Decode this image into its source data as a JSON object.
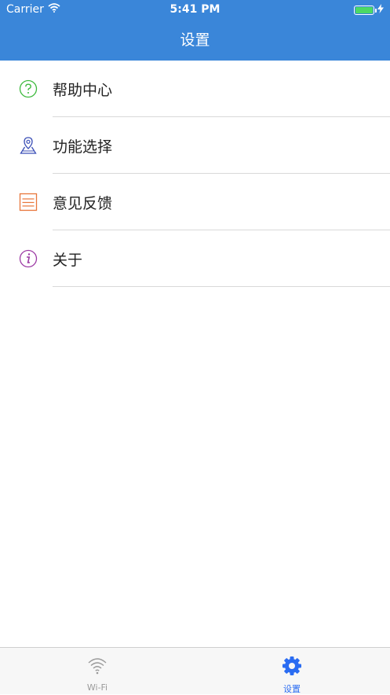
{
  "status_bar": {
    "carrier": "Carrier",
    "time": "5:41 PM",
    "battery_color": "#4cd964"
  },
  "nav": {
    "title": "设置",
    "background": "#3a86d9"
  },
  "menu": {
    "items": [
      {
        "label": "帮助中心",
        "icon": "help-icon",
        "icon_color": "#3cb93c"
      },
      {
        "label": "功能选择",
        "icon": "location-pin-icon",
        "icon_color": "#3b4fb6"
      },
      {
        "label": "意见反馈",
        "icon": "feedback-list-icon",
        "icon_color": "#e8763a"
      },
      {
        "label": "关于",
        "icon": "info-icon",
        "icon_color": "#9c3aa4"
      }
    ]
  },
  "tabbar": {
    "tabs": [
      {
        "label": "Wi-Fi",
        "icon": "wifi-icon",
        "selected": false,
        "color": "#9a9a9a"
      },
      {
        "label": "设置",
        "icon": "gear-icon",
        "selected": true,
        "color": "#2a6cf2"
      }
    ]
  }
}
